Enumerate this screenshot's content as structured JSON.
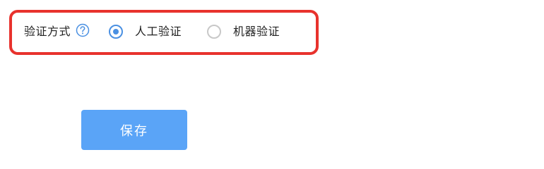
{
  "form": {
    "verification_method": {
      "label": "验证方式",
      "help_icon": "question-circle-icon",
      "options": [
        {
          "label": "人工验证",
          "checked": true
        },
        {
          "label": "机器验证",
          "checked": false
        }
      ]
    }
  },
  "actions": {
    "save_label": "保存"
  },
  "colors": {
    "highlight_border": "#e8322d",
    "accent": "#4a90e2",
    "save_button_bg": "#5aa4f7",
    "radio_unchecked_border": "#c8c8c8",
    "text": "#222222"
  }
}
